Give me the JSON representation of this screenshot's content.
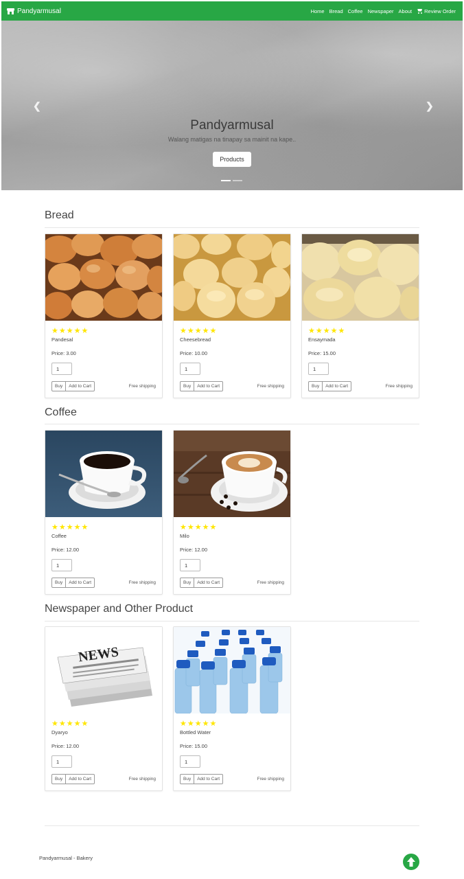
{
  "navbar": {
    "brand": "Pandyarmusal",
    "links": [
      "Home",
      "Bread",
      "Coffee",
      "Newspaper",
      "About"
    ],
    "review_order": "Review Order"
  },
  "hero": {
    "title": "Pandyarmusal",
    "subtitle": "Walang matigas na tinapay sa mainit na kape..",
    "button": "Products",
    "prev_icon": "chevron-left-icon",
    "next_icon": "chevron-right-icon",
    "slide_count": 2,
    "active_slide": 1
  },
  "sections": [
    {
      "title": "Bread",
      "products": [
        {
          "name": "Pandesal",
          "price": "Price: 3.00",
          "rating": 5,
          "qty": "1",
          "image": "pandesal-bread-rolls"
        },
        {
          "name": "Cheesebread",
          "price": "Price: 10.00",
          "rating": 5,
          "qty": "1",
          "image": "cheesebread-rolls"
        },
        {
          "name": "Ensaymada",
          "price": "Price: 15.00",
          "rating": 5,
          "qty": "1",
          "image": "ensaymada-pastries"
        }
      ]
    },
    {
      "title": "Coffee",
      "products": [
        {
          "name": "Coffee",
          "price": "Price: 12.00",
          "rating": 5,
          "qty": "1",
          "image": "black-coffee-cup"
        },
        {
          "name": "Milo",
          "price": "Price: 12.00",
          "rating": 5,
          "qty": "1",
          "image": "latte-art-cup"
        }
      ]
    },
    {
      "title": "Newspaper and Other Product",
      "products": [
        {
          "name": "Dyaryo",
          "price": "Price: 12.00",
          "rating": 5,
          "qty": "1",
          "image": "newspaper-stack"
        },
        {
          "name": "Bottled Water",
          "price": "Price: 15.00",
          "rating": 5,
          "qty": "1",
          "image": "bottled-water-rows"
        }
      ]
    }
  ],
  "card_labels": {
    "buy": "Buy",
    "add_to_cart": "Add to Cart",
    "shipping": "Free shipping"
  },
  "footer": {
    "text": "Pandyarmusal - Bakery",
    "to_top_icon": "arrow-up-circle-icon"
  },
  "colors": {
    "primary": "#28a745",
    "star": "#ffe600"
  }
}
